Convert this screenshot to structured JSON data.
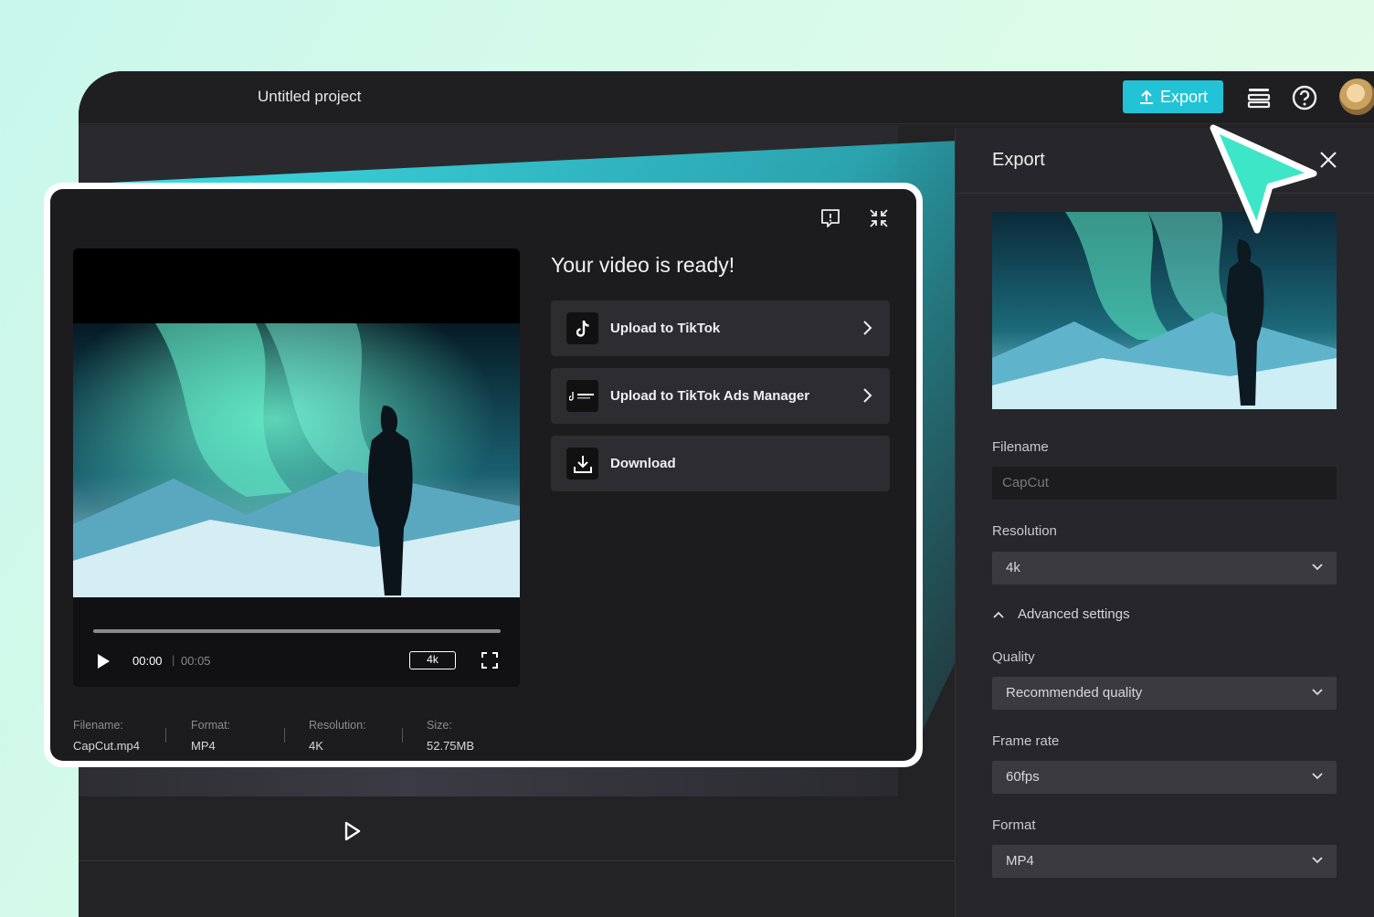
{
  "app": {
    "project_title": "Untitled project"
  },
  "toolbar": {
    "export_label": "Export",
    "icons": [
      "upload-icon",
      "layers-icon",
      "help-icon",
      "avatar"
    ]
  },
  "colors": {
    "accent": "#22c3d6",
    "panel_bg": "#27272b",
    "modal_bg": "#1c1c1f",
    "cursor": "#3ee6c8"
  },
  "export_panel": {
    "title": "Export",
    "filename_label": "Filename",
    "filename_value": "CapCut",
    "resolution_label": "Resolution",
    "resolution_value": "4k",
    "advanced_label": "Advanced settings",
    "quality_label": "Quality",
    "quality_value": "Recommended quality",
    "framerate_label": "Frame rate",
    "framerate_value": "60fps",
    "format_label": "Format",
    "format_value": "MP4"
  },
  "modal": {
    "title": "Your video is ready!",
    "actions": [
      {
        "label": "Upload to TikTok",
        "icon": "tiktok-icon"
      },
      {
        "label": "Upload to TikTok Ads Manager",
        "icon": "tiktok-business-icon"
      },
      {
        "label": "Download",
        "icon": "download-icon"
      }
    ],
    "player": {
      "time_current": "00:00",
      "time_separator": "|",
      "time_total": "00:05",
      "resolution_badge": "4k"
    },
    "meta": [
      {
        "key": "Filename:",
        "value": "CapCut.mp4"
      },
      {
        "key": "Format:",
        "value": "MP4"
      },
      {
        "key": "Resolution:",
        "value": "4K"
      },
      {
        "key": "Size:",
        "value": "52.75MB"
      }
    ]
  }
}
